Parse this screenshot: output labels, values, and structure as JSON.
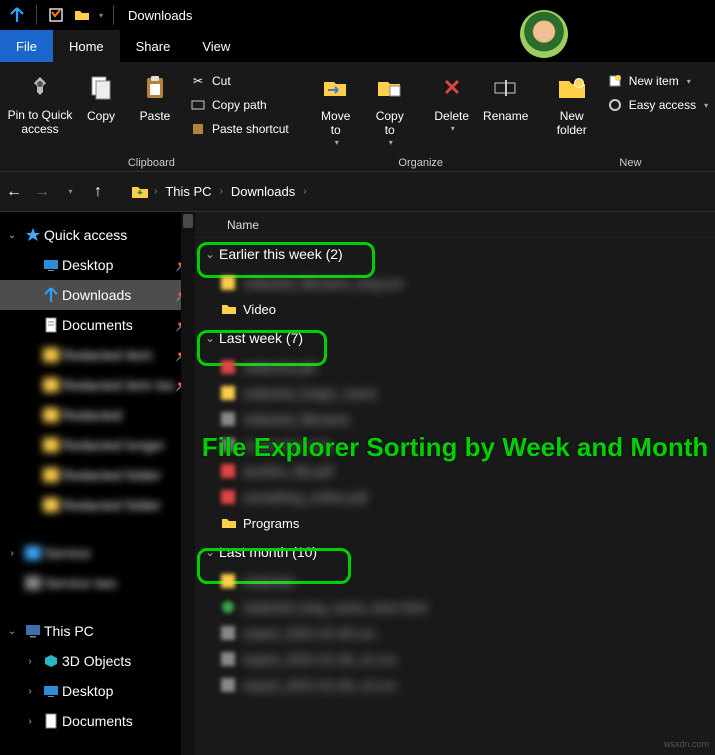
{
  "window": {
    "title": "Downloads"
  },
  "tabs": {
    "file": "File",
    "home": "Home",
    "share": "Share",
    "view": "View"
  },
  "ribbon": {
    "pin": "Pin to Quick\naccess",
    "copy": "Copy",
    "paste": "Paste",
    "cut": "Cut",
    "copypath": "Copy path",
    "pasteshortcut": "Paste shortcut",
    "clipboard_label": "Clipboard",
    "moveto": "Move\nto",
    "copyto": "Copy\nto",
    "delete": "Delete",
    "rename": "Rename",
    "organize_label": "Organize",
    "newfolder": "New\nfolder",
    "newitem": "New item",
    "easyaccess": "Easy access",
    "new_label": "New"
  },
  "breadcrumb": {
    "thispc": "This PC",
    "downloads": "Downloads"
  },
  "tree": {
    "quickaccess": "Quick access",
    "desktop": "Desktop",
    "downloads": "Downloads",
    "documents": "Documents",
    "thispc": "This PC",
    "threeD": "3D Objects",
    "desktop2": "Desktop",
    "documents2": "Documents"
  },
  "content": {
    "name_header": "Name",
    "groups": {
      "earlier_week": "Earlier this week (2)",
      "last_week": "Last week (7)",
      "last_month": "Last month (10)"
    },
    "items": {
      "video": "Video",
      "programs": "Programs"
    }
  },
  "overlay": "File Explorer Sorting by Week and Month",
  "watermark": "wsxdn.com"
}
